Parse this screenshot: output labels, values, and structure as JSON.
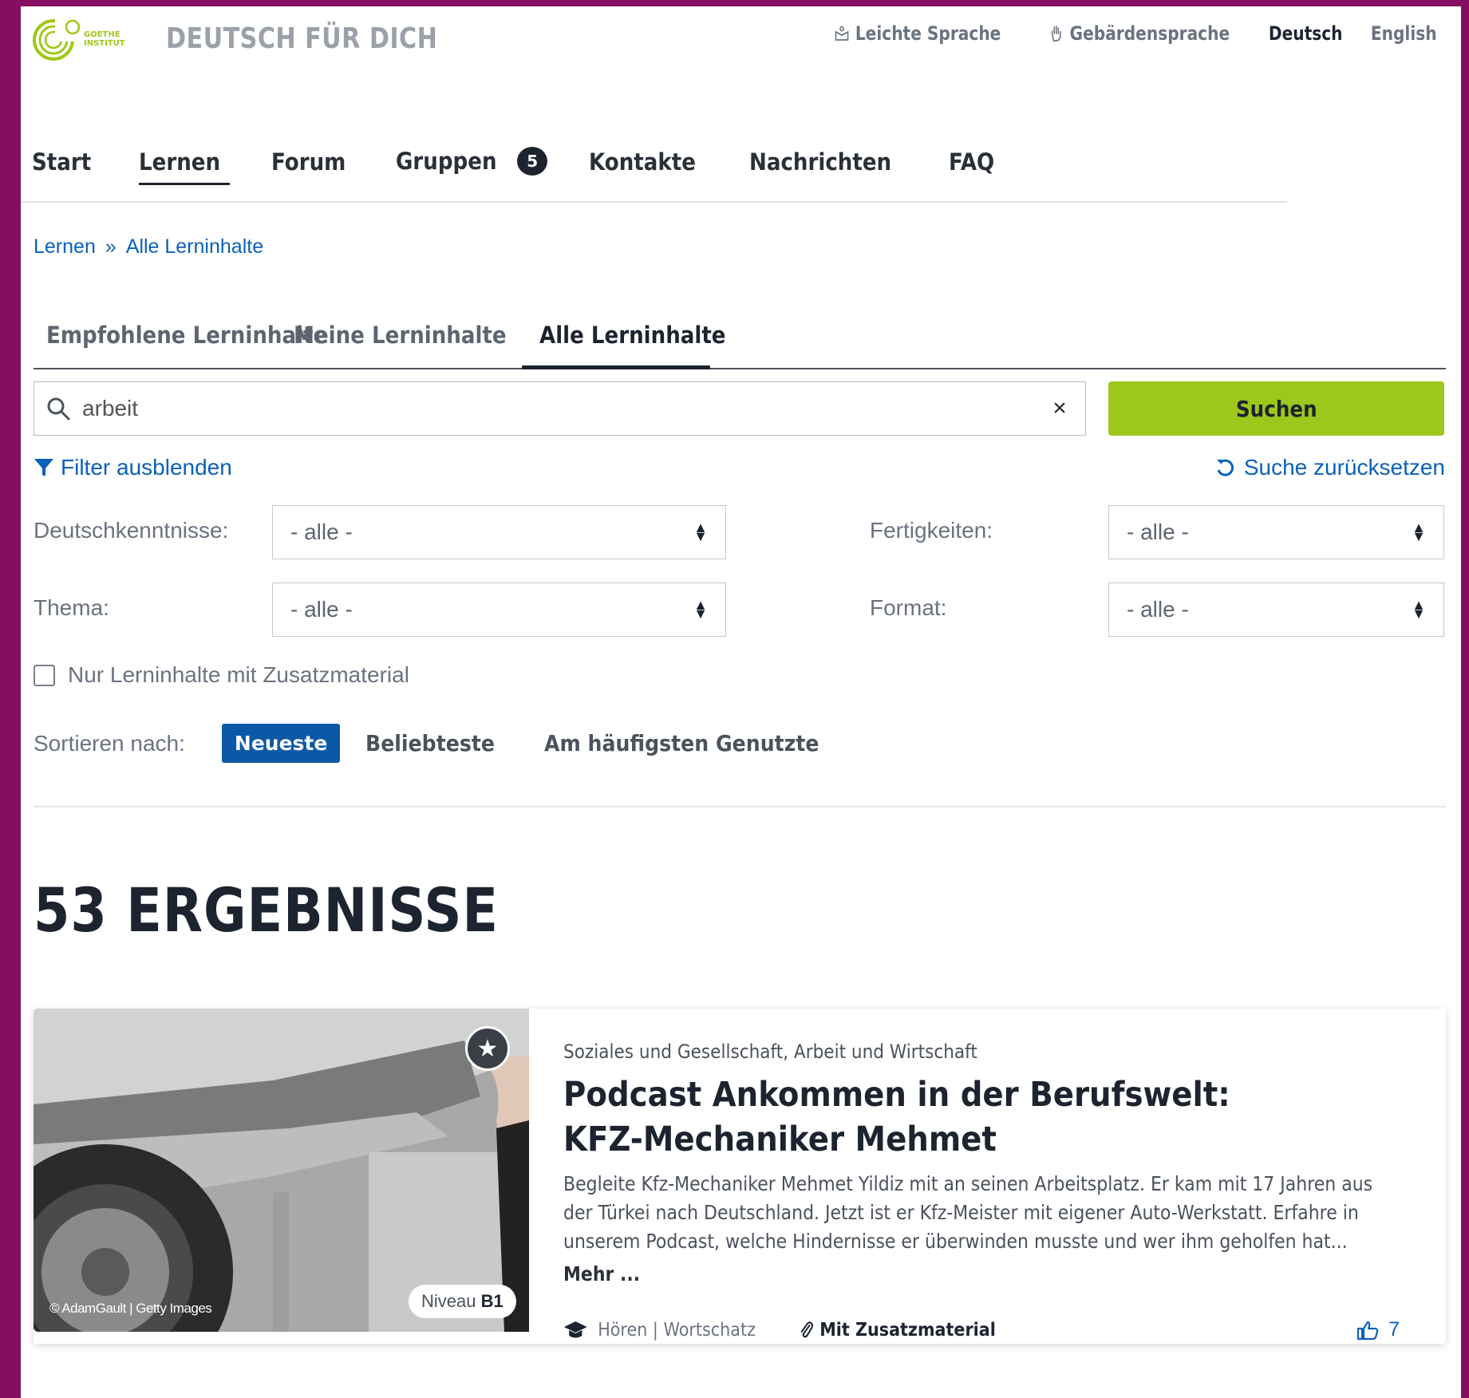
{
  "header": {
    "logo_text_line1": "GOETHE",
    "logo_text_line2": "INSTITUT",
    "site_title": "DEUTSCH FÜR DICH",
    "links": {
      "easy_language": "Leichte Sprache",
      "sign_language": "Gebärdensprache",
      "lang_de": "Deutsch",
      "lang_en": "English"
    }
  },
  "mainnav": {
    "start": "Start",
    "lernen": "Lernen",
    "forum": "Forum",
    "gruppen": "Gruppen",
    "gruppen_badge": "5",
    "kontakte": "Kontakte",
    "nachrichten": "Nachrichten",
    "faq": "FAQ"
  },
  "breadcrumb": {
    "root": "Lernen",
    "sep": "»",
    "current": "Alle Lerninhalte"
  },
  "tabs": {
    "recommended": "Empfohlene Lerninhalte",
    "mine": "Meine Lerninhalte",
    "all": "Alle Lerninhalte"
  },
  "search": {
    "value": "arbeit",
    "clear": "×",
    "button": "Suchen",
    "filter_toggle": "Filter ausblenden",
    "reset": "Suche zurücksetzen"
  },
  "filters": {
    "deutsch_label": "Deutschkenntnisse:",
    "deutsch_value": "- alle -",
    "fertig_label": "Fertigkeiten:",
    "fertig_value": "- alle -",
    "thema_label": "Thema:",
    "thema_value": "- alle -",
    "format_label": "Format:",
    "format_value": "- alle -",
    "zusatz_label": "Nur Lerninhalte mit Zusatzmaterial"
  },
  "sort": {
    "label": "Sortieren nach:",
    "newest": "Neueste",
    "popular": "Beliebteste",
    "most_used": "Am häufigsten Genutzte"
  },
  "results": {
    "heading": "53 ERGEBNISSE"
  },
  "card": {
    "category": "Soziales und Gesellschaft, Arbeit und Wirtschaft",
    "title": "Podcast Ankommen in der Berufswelt: KFZ-Mechaniker Mehmet",
    "description": "Begleite Kfz-Mechaniker Mehmet Yildiz mit an seinen Arbeitsplatz. Er kam mit 17 Jahren aus der Türkei nach Deutschland. Jetzt ist er Kfz-Meister mit eigener Auto-Werkstatt. Erfahre in unserem Podcast, welche Hindernisse er überwinden musste und wer ihm geholfen hat...",
    "more": "Mehr ...",
    "credit": "© AdamGault | Getty Images",
    "niveau_label": "Niveau",
    "niveau_value": "B1",
    "skills": "Hören | Wortschatz",
    "zusatz": "Mit Zusatzmaterial",
    "likes": "7"
  },
  "colors": {
    "frame": "#850e62",
    "accent_green": "#9cc71c",
    "link_blue": "#0b61b8",
    "sort_active": "#0b59a6",
    "text_dark": "#1d2430"
  }
}
